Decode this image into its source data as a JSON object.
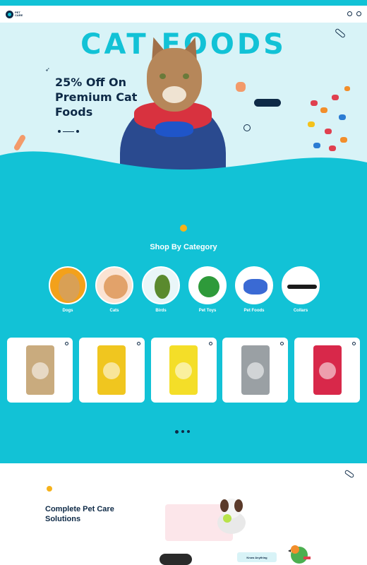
{
  "ticker": {
    "items": [
      "",
      "",
      "",
      "",
      "",
      "",
      "",
      "",
      "",
      "",
      "",
      ""
    ]
  },
  "header": {
    "logo_text_1": "PET",
    "logo_text_2": "CARE",
    "nav": [
      "",
      "",
      "",
      "",
      "",
      ""
    ]
  },
  "hero": {
    "title": "CAT   FOODS",
    "kicker": "",
    "heading": "25% Off On Premium Cat Foods",
    "desc": "",
    "cta": ""
  },
  "categories": {
    "title": "Shop By Category",
    "items": [
      {
        "label": "Dogs",
        "icon": "dog-photo"
      },
      {
        "label": "Cats",
        "icon": "cat-photo"
      },
      {
        "label": "Birds",
        "icon": "bird-photo"
      },
      {
        "label": "Pet Toys",
        "icon": "toy-ball-photo"
      },
      {
        "label": "Pet Foods",
        "icon": "food-bowl-photo"
      },
      {
        "label": "Collars",
        "icon": "collar-photo"
      }
    ]
  },
  "products": [
    {
      "name": "",
      "color": "#c9ab7e"
    },
    {
      "name": "",
      "color": "#f0c61f"
    },
    {
      "name": "",
      "color": "#f4de28"
    },
    {
      "name": "",
      "color": "#9aa0a4"
    },
    {
      "name": "",
      "color": "#d8284a"
    }
  ],
  "care": {
    "kicker": "",
    "title": "Complete Pet Care Solutions",
    "text": "",
    "card_kicker": "",
    "card_text": "",
    "button": "Know Anything"
  },
  "colors": {
    "accent": "#12c2d6",
    "navy": "#0e2a47",
    "paw": "#f6b21b",
    "hero_bg": "#d8f3f7"
  }
}
